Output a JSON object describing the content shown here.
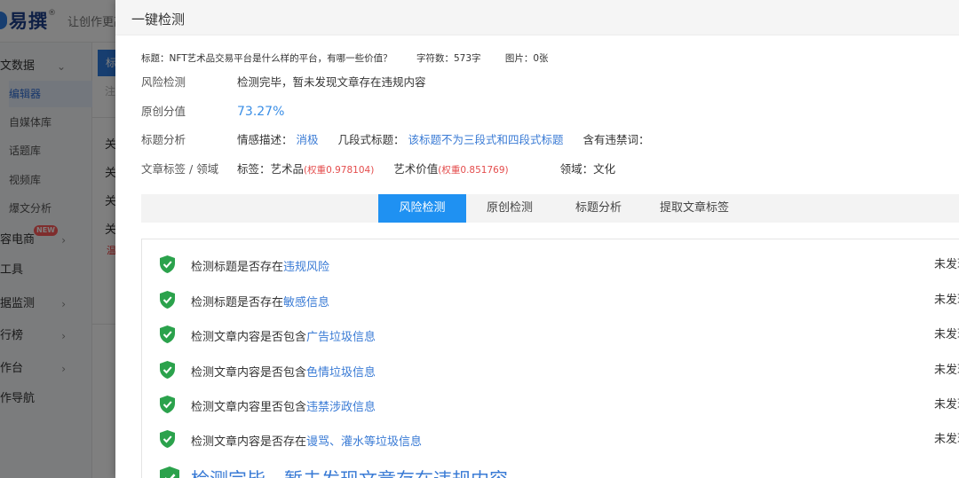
{
  "background": {
    "logo": {
      "brand": "易撰",
      "reg_mark": "®"
    },
    "slogan": "让创作更高",
    "sidebar": [
      {
        "label": "文数据",
        "arrow": "⌄"
      },
      {
        "label": "编辑器"
      },
      {
        "label": "自媒体库"
      },
      {
        "label": "话题库"
      },
      {
        "label": "视频库"
      },
      {
        "label": "爆文分析"
      },
      {
        "label": "容电商",
        "badge": "NEW",
        "arrow": "›"
      },
      {
        "label": "工具"
      },
      {
        "label": "据监测",
        "arrow": "›"
      },
      {
        "label": "行榜",
        "arrow": "›"
      },
      {
        "label": "作台",
        "arrow": "›"
      },
      {
        "label": "作导航"
      }
    ],
    "main": {
      "tab_fragment": "标",
      "placeholder_fragment": "注",
      "row_fragment": "关",
      "red_fragment": "温"
    }
  },
  "drawer": {
    "title": "一键检测",
    "meta": {
      "title_text": "标题：NFT艺术品交易平台是什么样的平台，有哪一些价值？",
      "word_count": "字符数：573字",
      "images": "图片：0张"
    },
    "risk": {
      "label": "风险检测",
      "value": "检测完毕，暂未发现文章存在违规内容"
    },
    "originality": {
      "label": "原创分值",
      "value": "73.27%"
    },
    "title_analysis": {
      "label": "标题分析",
      "sentiment_label": "情感描述：",
      "sentiment_value": "消极",
      "structure_label": "几段式标题：",
      "structure_value": "该标题不为三段式和四段式标题",
      "banned_label": "含有违禁词："
    },
    "tags": {
      "label": "文章标签 / 领域",
      "tag1_label": "标签：艺术品",
      "tag1_weight": "(权重0.978104)",
      "tag2_label": "艺术价值",
      "tag2_weight": "(权重0.851769)",
      "domain": "领域：文化"
    },
    "tabs": [
      "风险检测",
      "原创检测",
      "标题分析",
      "提取文章标签"
    ],
    "checks": [
      {
        "text": "检测标题是否存在",
        "highlight": "违规风险",
        "status": "未发现"
      },
      {
        "text": "检测标题是否存在",
        "highlight": "敏感信息",
        "status": "未发现"
      },
      {
        "text": "检测文章内容是否包含",
        "highlight": "广告垃圾信息",
        "status": "未发现"
      },
      {
        "text": "检测文章内容是否包含",
        "highlight": "色情垃圾信息",
        "status": "未发现"
      },
      {
        "text": "检测文章内容里否包含",
        "highlight": "违禁涉政信息",
        "status": "未发现"
      },
      {
        "text": "检测文章内容是否存在",
        "highlight": "谩骂、灌水等垃圾信息",
        "status": "未发现"
      }
    ],
    "final_message": "检测完毕，暂未发现文章存在违规内容",
    "colors": {
      "accent": "#1f91f2",
      "link": "#3a7bd5",
      "success": "#2ba24c",
      "weight": "#e44d4d"
    }
  }
}
